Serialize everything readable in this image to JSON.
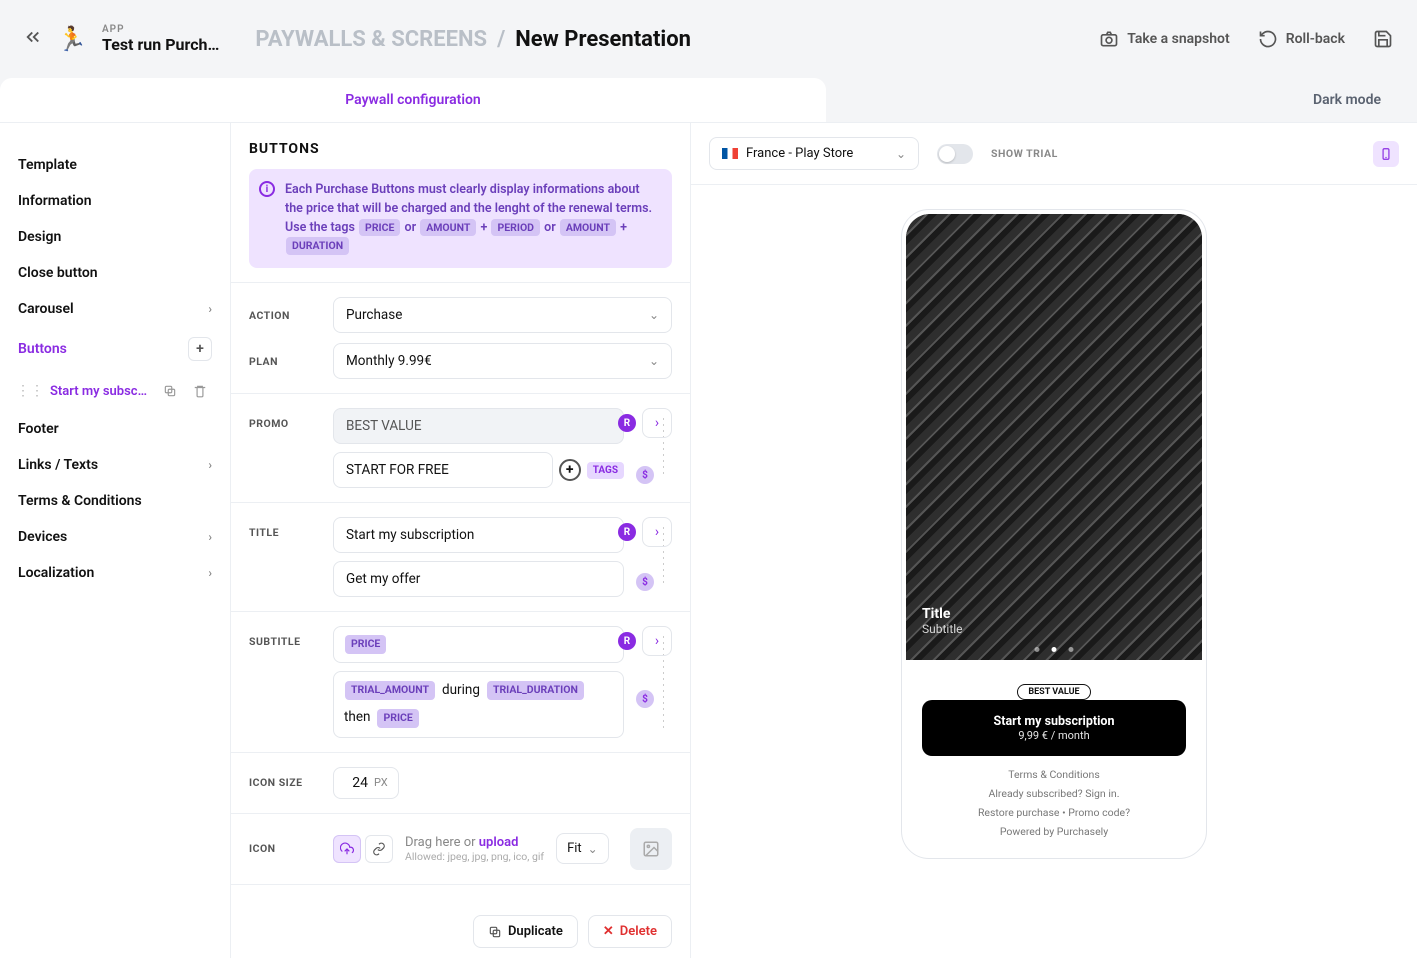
{
  "header": {
    "app_eyebrow": "APP",
    "app_title": "Test run Purch…",
    "icon": "🏃",
    "crumb1": "PAYWALLS & SCREENS",
    "crumb2": "New Presentation",
    "snapshot": "Take a snapshot",
    "rollback": "Roll-back"
  },
  "tabs": {
    "active": "Paywall configuration",
    "dark": "Dark mode"
  },
  "sidebar": {
    "items": [
      {
        "label": "Template",
        "chev": false
      },
      {
        "label": "Information",
        "chev": false
      },
      {
        "label": "Design",
        "chev": false
      },
      {
        "label": "Close button",
        "chev": false
      },
      {
        "label": "Carousel",
        "chev": true
      },
      {
        "label": "Buttons",
        "active": true,
        "add": true
      },
      {
        "label": "Footer",
        "chev": false
      },
      {
        "label": "Links / Texts",
        "chev": true
      },
      {
        "label": "Terms & Conditions",
        "chev": false
      },
      {
        "label": "Devices",
        "chev": true
      },
      {
        "label": "Localization",
        "chev": true
      }
    ],
    "sub_label": "Start my subsc…"
  },
  "editor": {
    "heading": "BUTTONS",
    "info": {
      "pre": "Each Purchase Buttons must clearly display informations about the price that will be charged and the lenght of the renewal terms. Use the tags",
      "or1": "or",
      "plus": "+",
      "or2": "or",
      "tags": [
        "PRICE",
        "AMOUNT",
        "PERIOD",
        "AMOUNT",
        "DURATION"
      ]
    },
    "action_label": "ACTION",
    "action_value": "Purchase",
    "plan_label": "PLAN",
    "plan_value": "Monthly 9.99€",
    "promo_label": "PROMO",
    "promo_value1": "BEST VALUE",
    "promo_value2": "START FOR FREE",
    "tags_btn": "TAGS",
    "title_label": "TITLE",
    "title_value1": "Start my subscription",
    "title_value2": "Get my offer",
    "subtitle_label": "SUBTITLE",
    "subtitle_tag1": "PRICE",
    "subtitle_tag2a": "TRIAL_AMOUNT",
    "subtitle_word1": "during",
    "subtitle_tag2b": "TRIAL_DURATION",
    "subtitle_word2": "then",
    "subtitle_tag2c": "PRICE",
    "icon_size_label": "ICON SIZE",
    "icon_size_value": "24",
    "icon_size_unit": "PX",
    "icon_label": "ICON",
    "drag_text": "Drag here or ",
    "upload_word": "upload",
    "allowed": "Allowed: jpeg, jpg, png, ico, gif",
    "fit": "Fit",
    "duplicate": "Duplicate",
    "delete": "Delete"
  },
  "preview": {
    "locale": "France - Play Store",
    "show_trial": "SHOW TRIAL",
    "hero_title": "Title",
    "hero_sub": "Subtitle",
    "best_value": "BEST VALUE",
    "cta_line1": "Start my subscription",
    "cta_line2": "9,99 € / month",
    "links": [
      "Terms & Conditions",
      "Already subscribed? Sign in.",
      "Restore purchase • Promo code?",
      "Powered by Purchasely"
    ]
  }
}
